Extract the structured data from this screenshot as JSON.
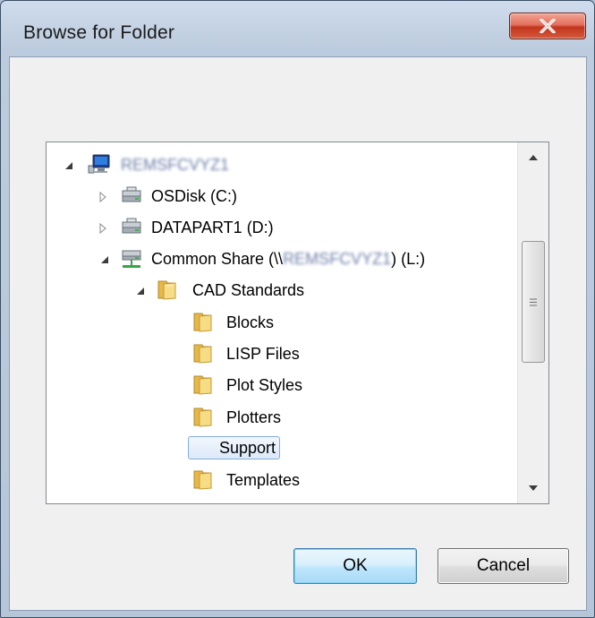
{
  "window": {
    "title": "Browse for Folder",
    "close_symbol": "X"
  },
  "tree": {
    "items": [
      {
        "label": "REMSFCVYZ1",
        "icon": "computer-icon",
        "expander": "expanded",
        "blurred": true
      },
      {
        "label": "OSDisk (C:)",
        "icon": "drive-icon",
        "expander": "collapsed"
      },
      {
        "label": "DATAPART1 (D:)",
        "icon": "drive-icon",
        "expander": "collapsed"
      },
      {
        "label_prefix": "Common Share (\\\\",
        "label_blurred": "REMSFCVYZ1",
        "label_suffix": ") (L:)",
        "icon": "network-drive-icon",
        "expander": "expanded"
      },
      {
        "label": "CAD Standards",
        "icon": "folder-open-icon",
        "expander": "expanded"
      },
      {
        "label": "Blocks",
        "icon": "folder-icon"
      },
      {
        "label": "LISP Files",
        "icon": "folder-icon"
      },
      {
        "label": "Plot Styles",
        "icon": "folder-icon"
      },
      {
        "label": "Plotters",
        "icon": "folder-icon"
      },
      {
        "label": "Support",
        "icon": "folder-icon",
        "selected": true
      },
      {
        "label": "Templates",
        "icon": "folder-icon"
      }
    ]
  },
  "buttons": {
    "ok": "OK",
    "cancel": "Cancel"
  },
  "colors": {
    "selection_border": "#84acdd",
    "close_red": "#c4361e",
    "ok_border": "#3c7fb1"
  }
}
